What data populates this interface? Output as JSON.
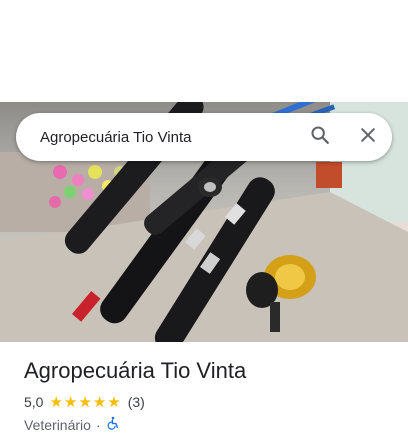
{
  "search": {
    "query": "Agropecuária Tio Vinta"
  },
  "place": {
    "name": "Agropecuária Tio Vinta",
    "rating": "5,0",
    "stars": [
      "★",
      "★",
      "★",
      "★",
      "★"
    ],
    "review_count": "(3)",
    "category": "Veterinário",
    "separator": "·"
  },
  "icons": {
    "search": "search-icon",
    "close": "close-icon",
    "accessibility": "wheelchair-accessible-icon"
  },
  "colors": {
    "star": "#fbbc04",
    "accessibility": "#1a73e8"
  }
}
